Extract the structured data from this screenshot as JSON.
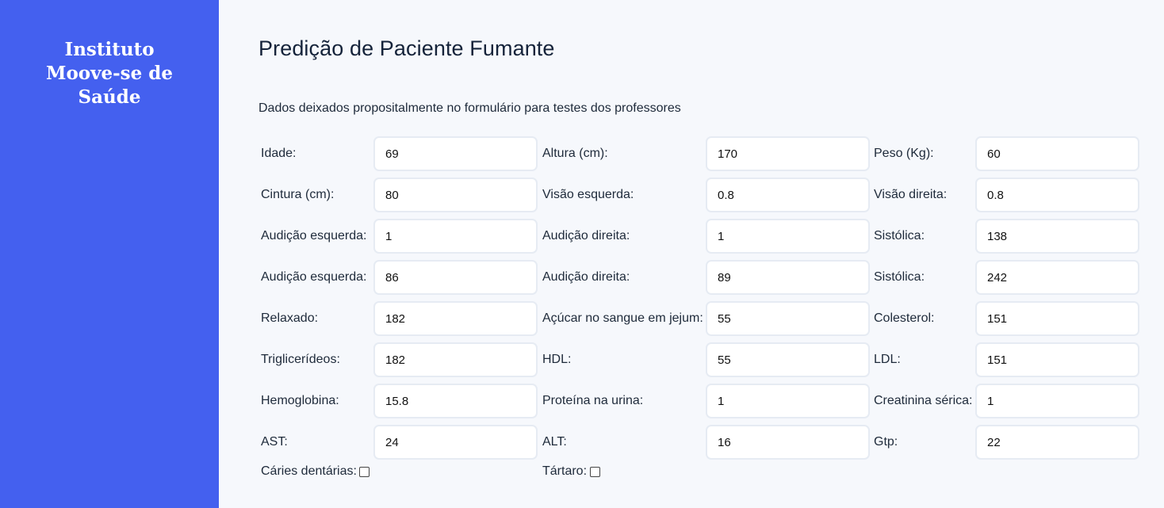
{
  "sidebar": {
    "brand": "Instituto\nMoove-se de\nSaúde"
  },
  "main": {
    "title": "Predição de Paciente Fumante",
    "subtitle": "Dados deixados propositalmente no formulário para testes dos professores"
  },
  "form": {
    "rows": [
      [
        {
          "label": "Idade:",
          "value": "69"
        },
        {
          "label": "Altura (cm):",
          "value": "170"
        },
        {
          "label": "Peso (Kg):",
          "value": "60"
        }
      ],
      [
        {
          "label": "Cintura (cm):",
          "value": "80"
        },
        {
          "label": "Visão esquerda:",
          "value": "0.8"
        },
        {
          "label": "Visão direita:",
          "value": "0.8"
        }
      ],
      [
        {
          "label": "Audição esquerda:",
          "value": "1"
        },
        {
          "label": "Audição direita:",
          "value": "1"
        },
        {
          "label": "Sistólica:",
          "value": "138"
        }
      ],
      [
        {
          "label": "Audição esquerda:",
          "value": "86"
        },
        {
          "label": "Audição direita:",
          "value": "89"
        },
        {
          "label": "Sistólica:",
          "value": "242"
        }
      ],
      [
        {
          "label": "Relaxado:",
          "value": "182"
        },
        {
          "label": "Açúcar no sangue em jejum:",
          "value": "55"
        },
        {
          "label": "Colesterol:",
          "value": "151"
        }
      ],
      [
        {
          "label": "Triglicerídeos:",
          "value": "182"
        },
        {
          "label": "HDL:",
          "value": "55"
        },
        {
          "label": "LDL:",
          "value": "151"
        }
      ],
      [
        {
          "label": "Hemoglobina:",
          "value": "15.8"
        },
        {
          "label": "Proteína na urina:",
          "value": "1"
        },
        {
          "label": "Creatinina sérica:",
          "value": "1"
        }
      ],
      [
        {
          "label": "AST:",
          "value": "24"
        },
        {
          "label": "ALT:",
          "value": "16"
        },
        {
          "label": "Gtp:",
          "value": "22"
        }
      ]
    ],
    "checkboxes": [
      {
        "label": "Cáries dentárias:",
        "checked": false
      },
      {
        "label": "Tártaro:",
        "checked": false
      }
    ]
  },
  "colors": {
    "sidebar_bg": "#4460ef",
    "page_bg": "#f6f8fc",
    "input_border": "#e6ebf3"
  }
}
